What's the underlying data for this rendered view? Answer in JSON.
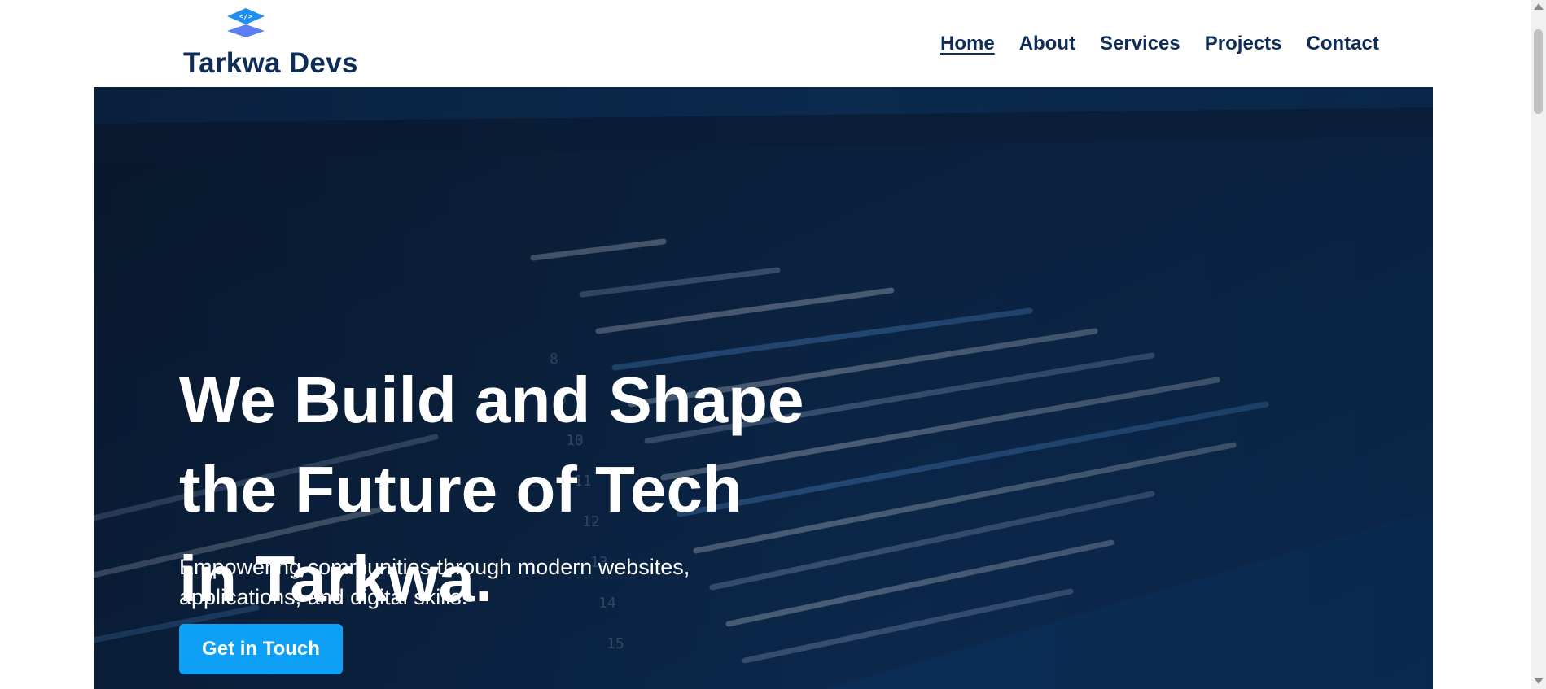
{
  "brand": {
    "name": "Tarkwa Devs",
    "logo_icon": "code-layers-icon",
    "color": "#0e2c57"
  },
  "nav": {
    "items": [
      {
        "label": "Home",
        "active": true
      },
      {
        "label": "About",
        "active": false
      },
      {
        "label": "Services",
        "active": false
      },
      {
        "label": "Projects",
        "active": false
      },
      {
        "label": "Contact",
        "active": false
      }
    ]
  },
  "hero": {
    "title_lines": [
      "We Build and Shape",
      "the Future of Tech",
      "in Tarkwa."
    ],
    "subtitle": "Empowering communities through modern websites, applications, and digital skills.",
    "cta_label": "Get in Touch",
    "cta_color": "#0ea0f5",
    "background": "code-editor-screenshot"
  }
}
